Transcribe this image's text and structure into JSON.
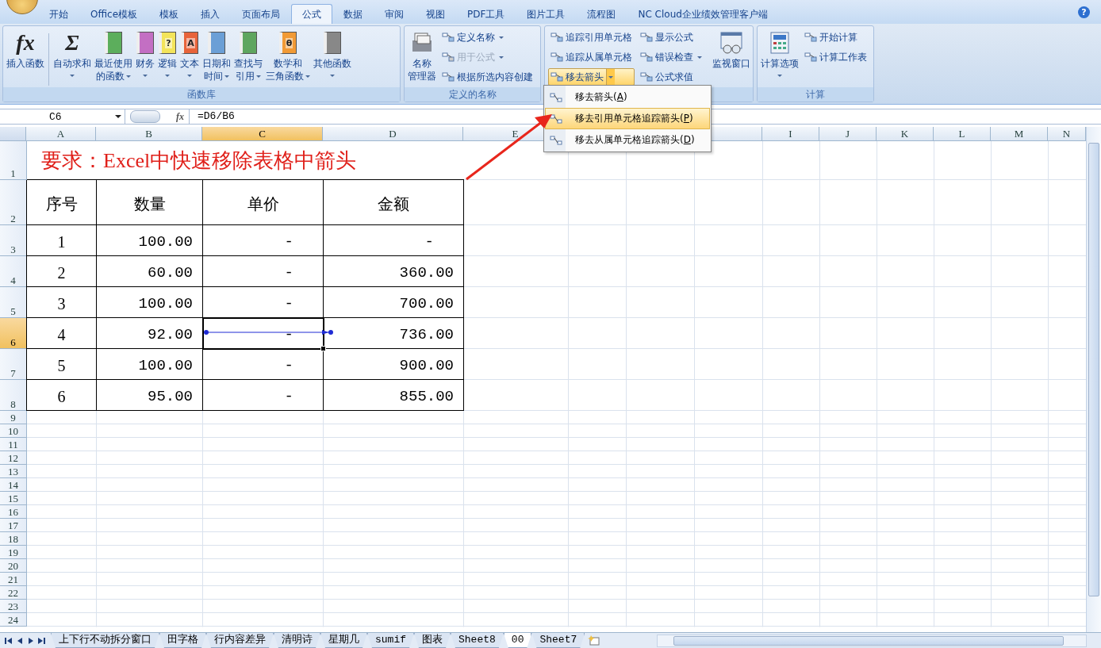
{
  "title_bar": {
    "help_glyph": "?",
    "tabs": [
      {
        "label": "开始",
        "selected": false
      },
      {
        "label": "Office模板",
        "selected": false
      },
      {
        "label": "模板",
        "selected": false
      },
      {
        "label": "插入",
        "selected": false
      },
      {
        "label": "页面布局",
        "selected": false
      },
      {
        "label": "公式",
        "selected": true
      },
      {
        "label": "数据",
        "selected": false
      },
      {
        "label": "审阅",
        "selected": false
      },
      {
        "label": "视图",
        "selected": false
      },
      {
        "label": "PDF工具",
        "selected": false
      },
      {
        "label": "图片工具",
        "selected": false
      },
      {
        "label": "流程图",
        "selected": false
      },
      {
        "label": "NC Cloud企业绩效管理客户端",
        "selected": false
      }
    ]
  },
  "ribbon": {
    "groups": [
      {
        "label": "函数库",
        "columns": [
          {
            "kind": "large",
            "button": {
              "lines": [
                "插入函数"
              ],
              "glyph": "fx",
              "dropdown": false
            }
          },
          {
            "kind": "separator"
          },
          {
            "kind": "large",
            "button": {
              "lines": [
                "自动求和"
              ],
              "glyph": "Σ",
              "dropdown": true
            }
          },
          {
            "kind": "large",
            "button": {
              "lines": [
                "最近使用",
                "的函数"
              ],
              "dropdown": true
            }
          },
          {
            "kind": "large",
            "button": {
              "lines": [
                "财务"
              ],
              "dropdown": true
            }
          },
          {
            "kind": "large",
            "button": {
              "lines": [
                "逻辑"
              ],
              "glyph": "?",
              "dropdown": true
            }
          },
          {
            "kind": "large",
            "button": {
              "lines": [
                "文本"
              ],
              "glyph": "A",
              "dropdown": true
            }
          },
          {
            "kind": "large",
            "button": {
              "lines": [
                "日期和",
                "时间"
              ],
              "dropdown": true
            }
          },
          {
            "kind": "large",
            "button": {
              "lines": [
                "查找与",
                "引用"
              ],
              "dropdown": true
            }
          },
          {
            "kind": "large",
            "button": {
              "lines": [
                "数学和",
                "三角函数"
              ],
              "glyph": "θ",
              "dropdown": true
            }
          },
          {
            "kind": "large",
            "button": {
              "lines": [
                "其他函数"
              ],
              "dropdown": true
            }
          }
        ]
      },
      {
        "label": "定义的名称",
        "columns": [
          {
            "kind": "large",
            "button": {
              "lines": [
                "名称",
                "管理器"
              ],
              "dropdown": false
            }
          },
          {
            "kind": "small",
            "buttons": [
              {
                "label": "定义名称",
                "dropdown": true,
                "disabled": false,
                "open": false
              },
              {
                "label": "用于公式",
                "dropdown": true,
                "disabled": true,
                "open": false
              },
              {
                "label": "根据所选内容创建",
                "dropdown": false,
                "disabled": false,
                "open": false
              }
            ]
          }
        ]
      },
      {
        "columns": [
          {
            "kind": "small",
            "buttons": [
              {
                "label": "追踪引用单元格",
                "dropdown": false,
                "disabled": false,
                "open": false
              },
              {
                "label": "追踪从属单元格",
                "dropdown": false,
                "disabled": false,
                "open": false
              },
              {
                "label": "移去箭头",
                "dropdown": true,
                "disabled": false,
                "open": true
              }
            ]
          },
          {
            "kind": "small",
            "buttons": [
              {
                "label": "显示公式",
                "dropdown": false,
                "disabled": false,
                "open": false
              },
              {
                "label": "错误检查",
                "dropdown": true,
                "disabled": false,
                "open": false
              },
              {
                "label": "公式求值",
                "dropdown": false,
                "disabled": false,
                "open": false
              }
            ]
          },
          {
            "kind": "separator"
          },
          {
            "kind": "large",
            "button": {
              "lines": [
                "监视窗口"
              ],
              "dropdown": false
            }
          }
        ]
      },
      {
        "label": "计算",
        "columns": [
          {
            "kind": "large",
            "button": {
              "lines": [
                "计算选项"
              ],
              "dropdown": true
            }
          },
          {
            "kind": "small",
            "buttons": [
              {
                "label": "开始计算",
                "dropdown": false,
                "disabled": false,
                "open": false
              },
              {
                "label": "计算工作表",
                "dropdown": false,
                "disabled": false,
                "open": false
              }
            ]
          }
        ]
      }
    ]
  },
  "menu": {
    "items": [
      {
        "label": "移去箭头",
        "accel": "(A)",
        "selected": false
      },
      {
        "label": "移去引用单元格追踪箭头",
        "accel": "(P)",
        "selected": true
      },
      {
        "label": "移去从属单元格追踪箭头",
        "accel": "(D)",
        "selected": false
      }
    ]
  },
  "formula_bar": {
    "name_box": "C6",
    "function_label": "fx",
    "formula": "=D6/B6"
  },
  "sheet": {
    "trace_arrow_shown": true,
    "columns": [
      {
        "label": "A",
        "selected": false
      },
      {
        "label": "B",
        "selected": false
      },
      {
        "label": "C",
        "selected": true
      },
      {
        "label": "D",
        "selected": false
      },
      {
        "label": "E",
        "selected": false
      },
      {},
      {},
      {
        "selected": false
      },
      {
        "label": "I",
        "selected": false
      },
      {
        "label": "J",
        "selected": false
      },
      {
        "label": "K",
        "selected": false
      },
      {
        "label": "L",
        "selected": false
      },
      {
        "label": "M",
        "selected": false
      },
      {
        "label": "N",
        "selected": false
      }
    ],
    "rows": [
      {
        "label": "1",
        "selected": false,
        "title": "要求：Excel中快速移除表格中箭头"
      },
      {
        "label": "2",
        "selected": false,
        "cells": [
          {
            "text": "序号",
            "kind": "header",
            "selected": false
          },
          {
            "text": "数量",
            "kind": "header",
            "selected": false
          },
          {
            "text": "单价",
            "kind": "header",
            "selected": false
          },
          {
            "text": "金额",
            "kind": "header",
            "selected": false
          }
        ]
      },
      {
        "label": "3",
        "selected": false,
        "cells": [
          {
            "text": "1",
            "kind": "index",
            "selected": false
          },
          {
            "text": "100.00",
            "kind": "number",
            "selected": false
          },
          {
            "text": "-",
            "kind": "dash",
            "selected": false
          },
          {
            "text": "-",
            "kind": "dash",
            "selected": false
          }
        ]
      },
      {
        "label": "4",
        "selected": false,
        "cells": [
          {
            "text": "2",
            "kind": "index",
            "selected": false
          },
          {
            "text": "60.00",
            "kind": "number",
            "selected": false
          },
          {
            "text": "-",
            "kind": "dash",
            "selected": false
          },
          {
            "text": "360.00",
            "kind": "number",
            "selected": false
          }
        ]
      },
      {
        "label": "5",
        "selected": false,
        "cells": [
          {
            "text": "3",
            "kind": "index",
            "selected": false
          },
          {
            "text": "100.00",
            "kind": "number",
            "selected": false
          },
          {
            "text": "-",
            "kind": "dash",
            "selected": false
          },
          {
            "text": "700.00",
            "kind": "number",
            "selected": false
          }
        ]
      },
      {
        "label": "6",
        "selected": true,
        "cells": [
          {
            "text": "4",
            "kind": "index",
            "selected": false
          },
          {
            "text": "92.00",
            "kind": "number",
            "selected": false
          },
          {
            "text": "-",
            "kind": "dash",
            "selected": true
          },
          {
            "text": "736.00",
            "kind": "number",
            "selected": false
          }
        ]
      },
      {
        "label": "7",
        "selected": false,
        "cells": [
          {
            "text": "5",
            "kind": "index",
            "selected": false
          },
          {
            "text": "100.00",
            "kind": "number",
            "selected": false
          },
          {
            "text": "-",
            "kind": "dash",
            "selected": false
          },
          {
            "text": "900.00",
            "kind": "number",
            "selected": false
          }
        ]
      },
      {
        "label": "8",
        "selected": false,
        "cells": [
          {
            "text": "6",
            "kind": "index",
            "selected": false
          },
          {
            "text": "95.00",
            "kind": "number",
            "selected": false
          },
          {
            "text": "-",
            "kind": "dash",
            "selected": false
          },
          {
            "text": "855.00",
            "kind": "number",
            "selected": false
          }
        ]
      },
      {
        "label": "9",
        "selected": false
      },
      {
        "label": "10",
        "selected": false
      },
      {
        "label": "11",
        "selected": false
      },
      {
        "label": "12",
        "selected": false
      },
      {
        "label": "13",
        "selected": false
      },
      {
        "label": "14",
        "selected": false
      },
      {
        "label": "15",
        "selected": false
      },
      {
        "label": "16",
        "selected": false
      },
      {
        "label": "17",
        "selected": false
      },
      {
        "label": "18",
        "selected": false
      },
      {
        "label": "19",
        "selected": false
      },
      {
        "label": "20",
        "selected": false
      },
      {
        "label": "21",
        "selected": false
      },
      {
        "label": "22",
        "selected": false
      },
      {
        "label": "23",
        "selected": false
      },
      {
        "label": "24",
        "selected": false
      }
    ]
  },
  "sheet_tabs": [
    {
      "label": "上下行不动拆分窗口",
      "selected": false
    },
    {
      "label": "田字格",
      "selected": false
    },
    {
      "label": "行内容差异",
      "selected": false
    },
    {
      "label": "清明诗",
      "selected": false
    },
    {
      "label": "星期几",
      "selected": false
    },
    {
      "label": "sumif",
      "selected": false
    },
    {
      "label": "图表",
      "selected": false
    },
    {
      "label": "Sheet8",
      "selected": false
    },
    {
      "label": "00",
      "selected": true
    },
    {
      "label": "Sheet7",
      "selected": false
    }
  ]
}
